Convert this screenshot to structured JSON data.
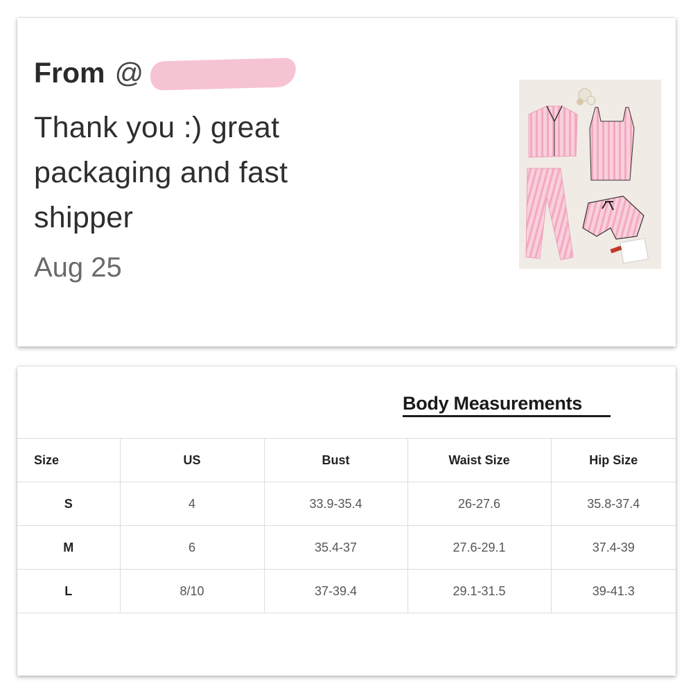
{
  "review": {
    "from_label": "From",
    "handle_visible": "@",
    "message": "Thank you :) great packaging and fast shipper",
    "date": "Aug 25",
    "redaction_color": "#f6c3d3",
    "photo_icon": "pink-striped-pajama-set-photo"
  },
  "measurements": {
    "title": "Body Measurements",
    "headers": [
      "Size",
      "US",
      "Bust",
      "Waist Size",
      "Hip Size"
    ],
    "rows": [
      [
        "S",
        "4",
        "33.9-35.4",
        "26-27.6",
        "35.8-37.4"
      ],
      [
        "M",
        "6",
        "35.4-37",
        "27.6-29.1",
        "37.4-39"
      ],
      [
        "L",
        "8/10",
        "37-39.4",
        "29.1-31.5",
        "39-41.3"
      ]
    ]
  }
}
